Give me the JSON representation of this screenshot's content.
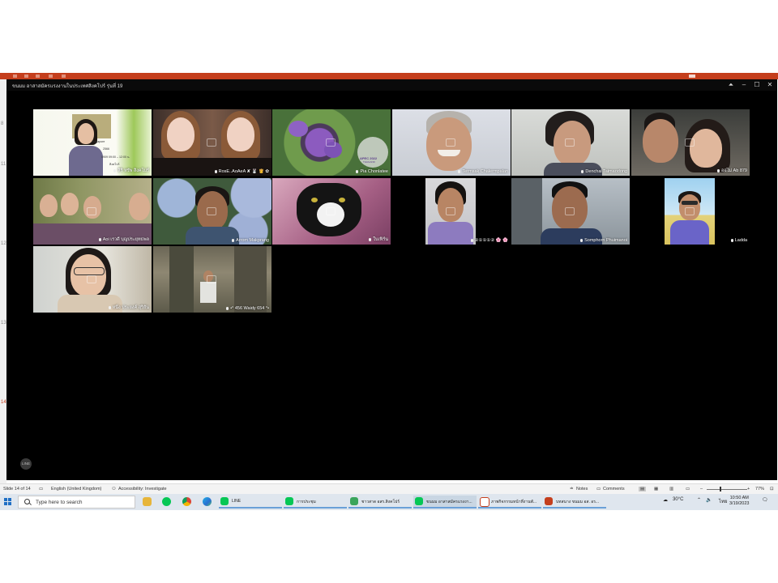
{
  "call": {
    "title": "ขนมม อาสาสมัครแรงงานในประเทศสิงคโปร์ รุ่นที่ 19",
    "line_badge": "LINE"
  },
  "participants": [
    {
      "name": "สิริ ทรัพ สิงคโปร์",
      "slide_text": [
        "Singapore",
        "2566",
        "0909 09:00 – 12:00 น.",
        "สิงคโปร์"
      ]
    },
    {
      "name": "RosE..AoAeA ✘ 🐰 👸 ✿"
    },
    {
      "name": "Pia Chonlatee",
      "logo_lines": [
        "APEC 2022",
        "THAILAND"
      ]
    },
    {
      "name": "Termsak Chalermpalan"
    },
    {
      "name": "Denchai Taimaodong"
    },
    {
      "name": "ออไม่ Ab 879"
    },
    {
      "name": "Aoi เรวดี บุญประยุทธพล"
    },
    {
      "name": "Arrom Makprang"
    },
    {
      "name": "ใบเฟิร์น"
    },
    {
      "name": "②①①①② 🌸 🌸"
    },
    {
      "name": "Somphorn Phuimanoi"
    },
    {
      "name": "Ladda"
    },
    {
      "name": "หนึ่ง ประยงค์ สุริยัน"
    },
    {
      "name": "•° 456 Waidy 654 °•"
    }
  ],
  "status_bar": {
    "slide": "Slide 14 of 14",
    "language": "English (United Kingdom)",
    "accessibility": "Accessibility: Investigate",
    "notes": "Notes",
    "comments": "Comments",
    "zoom": "77%"
  },
  "taskbar": {
    "search_placeholder": "Type here to search",
    "apps": [
      {
        "label": "LINE"
      },
      {
        "label": "การประชุม"
      },
      {
        "label": "ชาวสาด อสร.สิงคโปร์"
      },
      {
        "label": "ขนมม อาสาสมัครแรงงา..."
      },
      {
        "label": "ภาพกิจกรรมหน้าที่งานพั..."
      },
      {
        "label": "บทสนาง ขนมม อส. อร..."
      }
    ],
    "weather": "30°C",
    "language": "ไทย",
    "time": "10:50 AM",
    "date": "3/19/2023"
  },
  "gutter_numbers": [
    "8",
    "11",
    "12",
    "13",
    "14"
  ],
  "colors": {
    "ppt_accent": "#c43e1c",
    "call_bg": "#000000",
    "taskbar_bg": "#dfe6ee",
    "line_green": "#06c755"
  }
}
